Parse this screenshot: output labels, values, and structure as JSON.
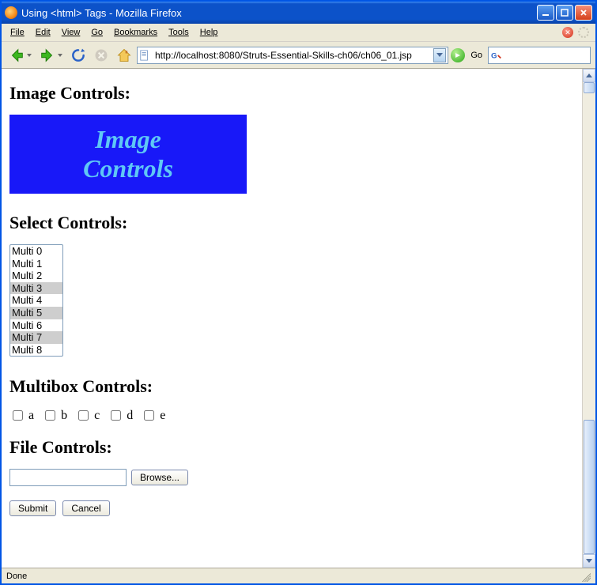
{
  "window": {
    "title": "Using <html> Tags - Mozilla Firefox"
  },
  "menu": {
    "file": "File",
    "edit": "Edit",
    "view": "View",
    "go": "Go",
    "bookmarks": "Bookmarks",
    "tools": "Tools",
    "help": "Help"
  },
  "toolbar": {
    "url": "http://localhost:8080/Struts-Essential-Skills-ch06/ch06_01.jsp",
    "go_label": "Go"
  },
  "page": {
    "headings": {
      "image": "Image Controls:",
      "select": "Select Controls:",
      "multibox": "Multibox Controls:",
      "file": "File Controls:"
    },
    "image_control": {
      "line1": "Image",
      "line2": "Controls"
    },
    "select_options": [
      {
        "label": "Multi 0",
        "selected": false
      },
      {
        "label": "Multi 1",
        "selected": false
      },
      {
        "label": "Multi 2",
        "selected": false
      },
      {
        "label": "Multi 3",
        "selected": true
      },
      {
        "label": "Multi 4",
        "selected": false
      },
      {
        "label": "Multi 5",
        "selected": true
      },
      {
        "label": "Multi 6",
        "selected": false
      },
      {
        "label": "Multi 7",
        "selected": true
      },
      {
        "label": "Multi 8",
        "selected": false
      }
    ],
    "multibox": [
      "a",
      "b",
      "c",
      "d",
      "e"
    ],
    "file_browse": "Browse...",
    "submit": "Submit",
    "cancel": "Cancel"
  },
  "status": {
    "text": "Done"
  }
}
